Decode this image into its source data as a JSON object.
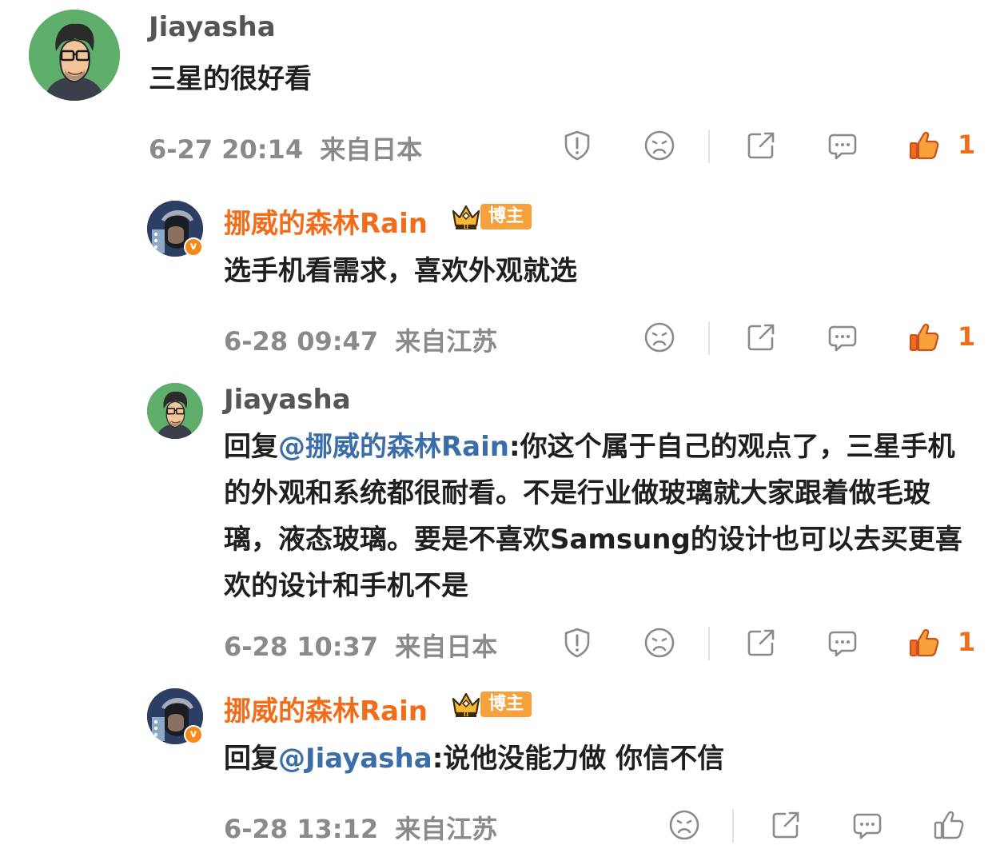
{
  "comments": [
    {
      "name": "Jiayasha",
      "text": "三星的很好看",
      "time": "6-27 20:14",
      "location": "来自日本",
      "likes": "1"
    },
    {
      "name": "挪威的森林Rain",
      "badge": "博主",
      "text": "选手机看需求，喜欢外观就选",
      "time": "6-28 09:47",
      "location": "来自江苏",
      "likes": "1"
    },
    {
      "name": "Jiayasha",
      "reply_prefix": "回复",
      "mention": "@挪威的森林Rain",
      "text": ":你这个属于自己的观点了，三星手机的外观和系统都很耐看。不是行业做玻璃就大家跟着做毛玻璃，液态玻璃。要是不喜欢Samsung的设计也可以去买更喜欢的设计和手机不是",
      "time": "6-28 10:37",
      "location": "来自日本",
      "likes": "1"
    },
    {
      "name": "挪威的森林Rain",
      "badge": "博主",
      "reply_prefix": "回复",
      "mention": "@Jiayasha",
      "text": ":说他没能力做 你信不信",
      "time": "6-28 13:12",
      "location": "来自江苏"
    }
  ],
  "colors": {
    "accent": "#f26d1b",
    "mention": "#3b6ea8",
    "meta": "#8a8a8a",
    "badge": "#f7a13d"
  },
  "icons": [
    "report-icon",
    "dislike-icon",
    "share-icon",
    "reply-icon",
    "like-icon",
    "verified-icon",
    "crown-icon"
  ]
}
